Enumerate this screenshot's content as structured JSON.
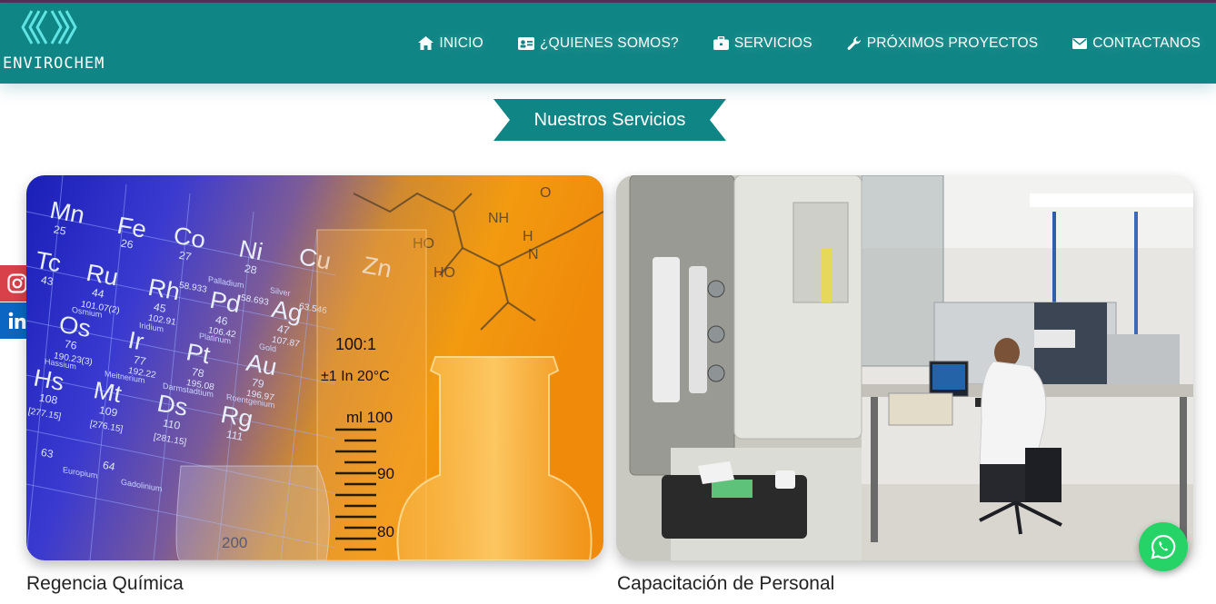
{
  "brand": {
    "name": "ENVIROCHEM",
    "accent": "#0f8585"
  },
  "nav": {
    "items": [
      {
        "label": "INICIO",
        "icon": "home-icon"
      },
      {
        "label": "¿QUIENES SOMOS?",
        "icon": "id-card-icon"
      },
      {
        "label": "SERVICIOS",
        "icon": "briefcase-icon"
      },
      {
        "label": "PRÓXIMOS PROYECTOS",
        "icon": "wrench-icon"
      },
      {
        "label": "CONTACTANOS",
        "icon": "envelope-icon"
      }
    ]
  },
  "section": {
    "title": "Nuestros Servicios"
  },
  "social": [
    {
      "name": "instagram-icon",
      "color": "#d8404a"
    },
    {
      "name": "linkedin-icon",
      "color": "#0a66c2"
    }
  ],
  "cards": [
    {
      "caption": "Regencia Química",
      "image_text": {
        "elements": [
          "Mn",
          "Fe",
          "Co",
          "Ni",
          "Cu",
          "Zn",
          "Tc",
          "Ru",
          "Rh",
          "Pd",
          "Ag",
          "Os",
          "Ir",
          "Pt",
          "Au",
          "Hs",
          "Mt",
          "Ds",
          "Rg"
        ],
        "numbers": [
          "25",
          "26",
          "27",
          "28",
          "43",
          "44",
          "45",
          "46",
          "47",
          "76",
          "77",
          "78",
          "79",
          "108",
          "109",
          "110",
          "111",
          "63",
          "64"
        ],
        "names": [
          "Palladium",
          "Silver",
          "Osmium",
          "Iridium",
          "Platinum",
          "Gold",
          "Hassium",
          "Meitnerium",
          "Darmstadtium",
          "Roentgenium",
          "Europium",
          "Gadolinium"
        ],
        "masses": [
          "58.933",
          "58.693",
          "63.546",
          "101.07(2)",
          "102.91",
          "106.42",
          "107.87",
          "190.23(3)",
          "192.22",
          "195.08",
          "196.97",
          "[277.15]",
          "[276.15]",
          "[281.15]"
        ],
        "beaker": [
          "100:1",
          "±1 In 20°C",
          "ml 100",
          "90",
          "80",
          "200"
        ],
        "molecule": [
          "NH",
          "HO",
          "H",
          "N",
          "O"
        ]
      },
      "image_theme": "periodic-table-and-lab-glassware"
    },
    {
      "caption": "Capacitación de Personal",
      "image_theme": "laboratory-technician-at-computer"
    }
  ],
  "whatsapp": {
    "icon": "whatsapp-icon",
    "color": "#25d366"
  }
}
